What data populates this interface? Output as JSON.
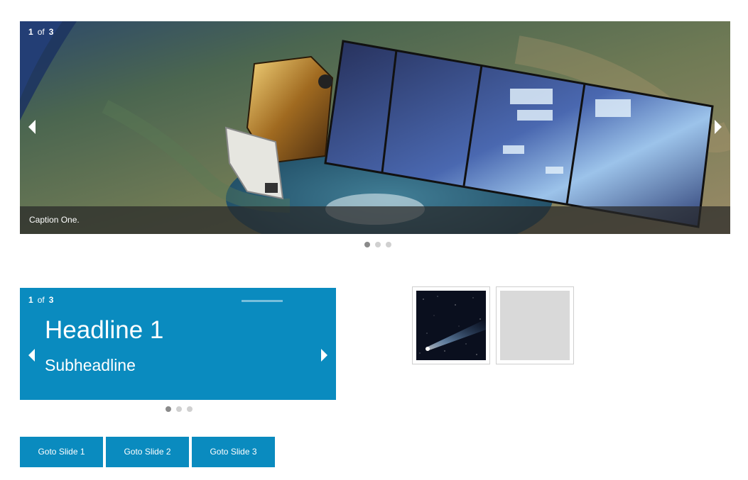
{
  "slider1": {
    "current": "1",
    "of": "of",
    "total": "3",
    "caption": "Caption One.",
    "image": "satellite-over-earth",
    "active_dot": 1,
    "dot_count": 3
  },
  "slider2": {
    "current": "1",
    "of": "of",
    "total": "3",
    "headline": "Headline 1",
    "subheadline": "Subheadline",
    "background_color": "#0a8bbf",
    "active_dot": 1,
    "dot_count": 3
  },
  "thumbnails": [
    {
      "image": "comet-in-space"
    },
    {
      "image": "placeholder"
    }
  ],
  "buttons": [
    {
      "label": "Goto Slide 1"
    },
    {
      "label": "Goto Slide 2"
    },
    {
      "label": "Goto Slide 3"
    }
  ],
  "colors": {
    "accent": "#0a8bbf",
    "dot_active": "#8a8a8a",
    "dot_inactive": "#d0d0d0"
  }
}
